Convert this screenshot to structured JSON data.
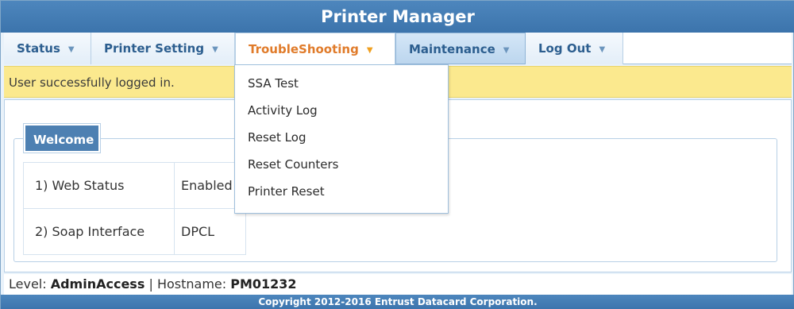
{
  "header": {
    "title": "Printer Manager"
  },
  "nav": {
    "items": [
      {
        "label": "Status"
      },
      {
        "label": "Printer Setting"
      },
      {
        "label": "TroubleShooting"
      },
      {
        "label": "Maintenance"
      },
      {
        "label": "Log Out"
      }
    ],
    "caret": "▼"
  },
  "message": "User successfully logged in.",
  "dropdown": {
    "items": [
      "SSA Test",
      "Activity Log",
      "Reset Log",
      "Reset Counters",
      "Printer Reset"
    ]
  },
  "welcome": {
    "legend": "Welcome",
    "rows": [
      {
        "key": "1) Web Status",
        "value": "Enabled"
      },
      {
        "key": "2) Soap Interface",
        "value": "DPCL"
      }
    ]
  },
  "footer": {
    "level_label": "Level:",
    "level_value": "AdminAccess",
    "separator": "|",
    "hostname_label": "Hostname:",
    "hostname_value": "PM01232",
    "copyright": "Copyright 2012-2016 Entrust Datacard Corporation."
  },
  "colors": {
    "header_blue": "#3c74ac",
    "active_tab_text": "#e07b2a",
    "message_bg": "#fbe98e"
  }
}
